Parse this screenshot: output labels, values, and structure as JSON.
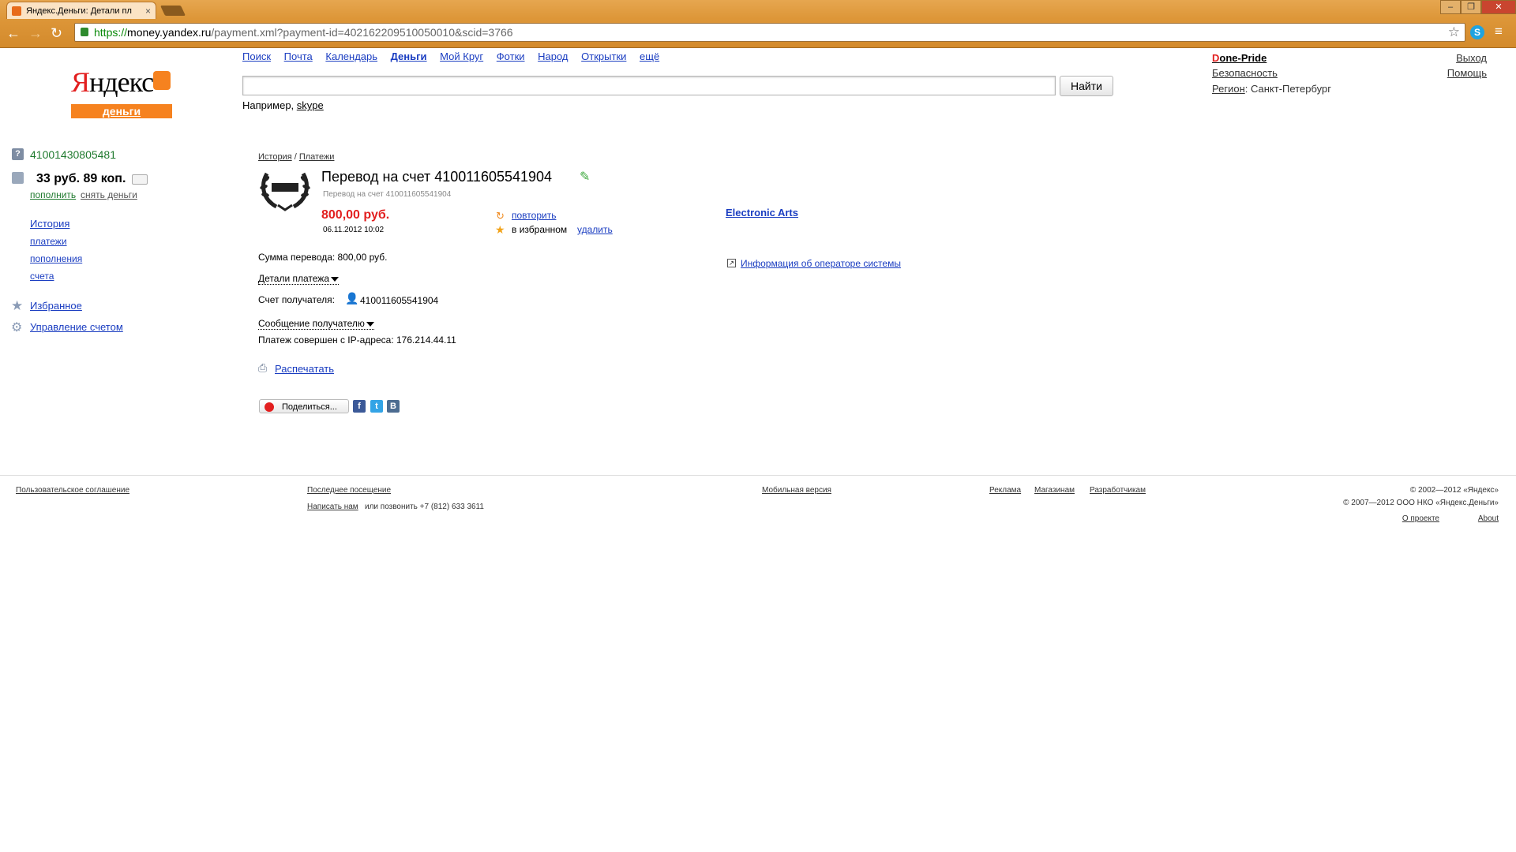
{
  "browser": {
    "tab_title": "Яндекс.Деньги: Детали пл",
    "tab_close": "×",
    "url_scheme": "https://",
    "url_host": "money.yandex.ru",
    "url_path": "/payment.xml?payment-id=402162209510050010&scid=3766",
    "window_controls": {
      "minimize": "–",
      "maximize": "❐",
      "close": "✕"
    },
    "nav": {
      "back": "←",
      "forward": "→",
      "reload": "↻"
    },
    "bookmark_star": "☆",
    "skype_ext": "S",
    "menu_ext": "≡"
  },
  "header": {
    "logo_word_first": "Я",
    "logo_word_rest": "ндекс",
    "logo_sub": "деньги",
    "services": [
      "Поиск",
      "Почта",
      "Календарь",
      "Деньги",
      "Мой Круг",
      "Фотки",
      "Народ",
      "Открытки",
      "ещё"
    ],
    "active_service": "Деньги",
    "search_value": "",
    "search_button": "Найти",
    "example_prefix": "Например,",
    "example_link": "skype"
  },
  "user": {
    "name_first": "D",
    "name_rest": "one-Pride",
    "security": "Безопасность",
    "region_label": "Регион",
    "region_value": ": Санкт-Петербург",
    "logout": "Выход",
    "help": "Помощь"
  },
  "sidebar": {
    "wallet_number": "41001430805481",
    "balance": "33 руб. 89 коп.",
    "topup": "пополнить",
    "withdraw": "снять деньги",
    "history": "История",
    "payments": "платежи",
    "topups": "пополнения",
    "accounts": "счета",
    "favorites": "Избранное",
    "manage": "Управление счетом"
  },
  "payment": {
    "breadcrumb_history": "История",
    "breadcrumb_sep": " / ",
    "breadcrumb_payments": "Платежи",
    "title": "Перевод на счет 410011605541904",
    "subtitle": "Перевод на счет 410011605541904",
    "amount": "800,00 руб.",
    "date": "06.11.2012 10:02",
    "repeat": "повторить",
    "in_favorites": "в избранном",
    "delete": "удалить",
    "merchant_link": "Electronic Arts",
    "operator_info": "Информация об операторе системы",
    "sum_line": "Сумма перевода: 800,00 руб.",
    "details_toggle": "Детали платежа",
    "recipient_label": "Счет получателя:",
    "recipient_value": "410011605541904",
    "message_toggle": "Сообщение получателю",
    "ip_line": "Платеж совершен с IP-адреса: 176.214.44.11",
    "print": "Распечатать",
    "share": "Поделиться...",
    "social": {
      "facebook": "f",
      "twitter": "t",
      "vkontakte": "B"
    }
  },
  "footer": {
    "agreement": "Пользовательское соглашение",
    "last_visit": "Последнее посещение",
    "write_us": "Написать нам",
    "call": "или позвонить +7 (812) 633 3611",
    "mobile": "Мобильная версия",
    "ads": "Реклама",
    "shops": "Магазинам",
    "developers": "Разработчикам",
    "copyright1": "© 2002—2012 «Яндекс»",
    "copyright2": "© 2007—2012 ООО НКО «Яндекс.Деньги»",
    "about_ru": "О проекте",
    "about_en": "About"
  },
  "colors": {
    "accent_orange": "#f6821f",
    "link_blue": "#1a3dc1",
    "amount_red": "#e21f1f",
    "wallet_green": "#1f7a2e"
  }
}
